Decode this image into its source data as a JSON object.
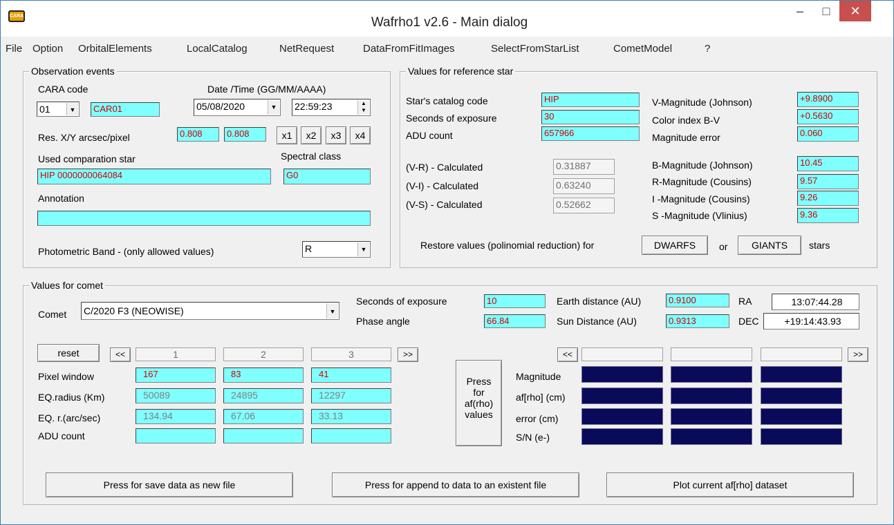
{
  "window": {
    "title": "Wafrho1 v2.6 - Main dialog",
    "app_icon": "CARA",
    "minimize": "–",
    "maximize": "□",
    "close": "✕"
  },
  "menu": [
    "File",
    "Option",
    "OrbitalElements",
    "LocalCatalog",
    "NetRequest",
    "DataFromFitImages",
    "SelectFromStarList",
    "CometModel",
    "?"
  ],
  "obs": {
    "legend": "Observation events",
    "cara_code_label": "CARA code",
    "cara_code_select": "01",
    "cara_code_value": "CAR01",
    "datetime_label": "Date /Time  (GG/MM/AAAA)",
    "date_value": "05/08/2020",
    "time_value": "22:59:23",
    "res_label": "Res. X/Y arcsec/pixel",
    "res_x": "0.808",
    "res_y": "0.808",
    "zoom_buttons": [
      "x1",
      "x2",
      "x3",
      "x4"
    ],
    "comp_star_label": "Used comparation star",
    "comp_star_value": "HIP 0000000064084",
    "spectral_label": "Spectral class",
    "spectral_value": "G0",
    "annotation_label": "Annotation",
    "annotation_value": "",
    "band_label": "Photometric Band  - (only allowed values)",
    "band_value": "R"
  },
  "ref": {
    "legend": "Values for reference star",
    "catalog_label": "Star's catalog code",
    "catalog_value": "HIP",
    "exposure_label": "Seconds of exposure",
    "exposure_value": "30",
    "adu_label": "ADU count",
    "adu_value": "657966",
    "vr_label": "(V-R) - Calculated",
    "vr_value": "0.31887",
    "vi_label": "(V-I) -  Calculated",
    "vi_value": "0.63240",
    "vs_label": "(V-S) - Calculated",
    "vs_value": "0.52662",
    "vmag_label": "V-Magnitude (Johnson)",
    "vmag_value": "+9.8900",
    "bv_label": "Color index B-V",
    "bv_value": "+0.5630",
    "magerr_label": "Magnitude error",
    "magerr_value": "0.060",
    "bmag_label": "B-Magnitude (Johnson)",
    "bmag_value": "10.45",
    "rmag_label": "R-Magnitude (Cousins)",
    "rmag_value": "9.57",
    "imag_label": "I -Magnitude (Cousins)",
    "imag_value": "9.26",
    "smag_label": "S -Magnitude (Vlinius)",
    "smag_value": "9.36",
    "restore_label": "Restore values (polinomial reduction) for",
    "dwarfs_button": "DWARFS",
    "or_label": "or",
    "giants_button": "GIANTS",
    "stars_label": "stars"
  },
  "comet": {
    "legend": "Values for comet",
    "comet_label": "Comet",
    "comet_value": "C/2020 F3 (NEOWISE)",
    "exposure_label": "Seconds of exposure",
    "exposure_value": "10",
    "phase_label": "Phase angle",
    "phase_value": "66.84",
    "earth_label": "Earth distance (AU)",
    "earth_value": "0.9100",
    "sun_label": "Sun Distance (AU)",
    "sun_value": "0.9313",
    "ra_label": "RA",
    "ra_value": "13:07:44.28",
    "dec_label": "DEC",
    "dec_value": "+19:14:43.93",
    "reset_button": "reset",
    "prev_button": "<<",
    "next_button": ">>",
    "columns": [
      "1",
      "2",
      "3"
    ],
    "pixel_window_label": "Pixel window",
    "pixel_window": [
      "167",
      "83",
      "41"
    ],
    "eq_radius_label": "EQ.radius (Km)",
    "eq_radius": [
      "50089",
      "24895",
      "12297"
    ],
    "eq_arcsec_label": "EQ. r.(arc/sec)",
    "eq_arcsec": [
      "134.94",
      "67.06",
      "33.13"
    ],
    "adu_label": "ADU count",
    "adu": [
      "",
      "",
      ""
    ],
    "press_button": "Press\nfor\naf(rho)\nvalues",
    "magnitude_label": "Magnitude",
    "afrho_label": "af[rho] (cm)",
    "error_label": "error (cm)",
    "sn_label": "S/N (e-)",
    "res_prev_button": "<<",
    "res_next_button": ">>"
  },
  "bottom": {
    "save_button": "Press for save data as new file",
    "append_button": "Press for append to  data to an existent file",
    "plot_button": "Plot current af[rho] dataset"
  },
  "colors": {
    "field": "#80ffff",
    "value_red": "#d00000",
    "navy": "#0a0a5a"
  }
}
